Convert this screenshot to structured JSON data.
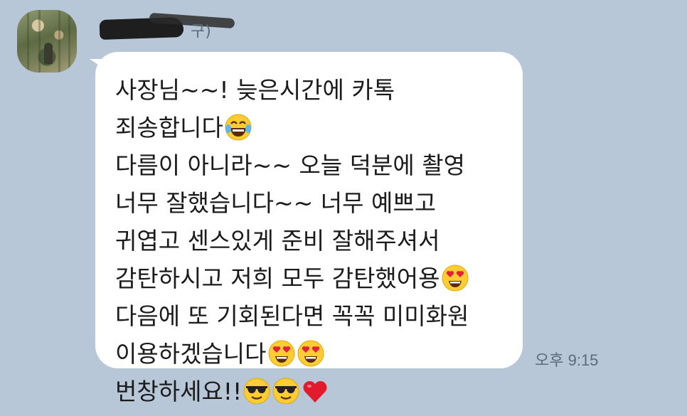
{
  "sender": {
    "name_suffix": "구)"
  },
  "message": {
    "lines": [
      {
        "text": "사장님~~! 늦은시간에 카톡",
        "emojis": []
      },
      {
        "text": "죄송합니다",
        "emojis": [
          "laugh-tears-emoji"
        ]
      },
      {
        "text": "다름이 아니라~~ 오늘 덕분에 촬영",
        "emojis": []
      },
      {
        "text": "너무 잘했습니다~~ 너무 예쁘고",
        "emojis": []
      },
      {
        "text": "귀엽고 센스있게 준비 잘해주셔서",
        "emojis": []
      },
      {
        "text": "감탄하시고 저희 모두 감탄했어용",
        "emojis": [
          "heart-eyes-emoji"
        ]
      },
      {
        "text": "다음에 또 기회된다면 꼭꼭 미미화원",
        "emojis": []
      },
      {
        "text": "이용하겠습니다",
        "emojis": [
          "heart-eyes-emoji",
          "heart-eyes-emoji"
        ]
      },
      {
        "text": "번창하세요!!",
        "emojis": [
          "sunglasses-emoji",
          "sunglasses-emoji",
          "red-heart-emoji"
        ]
      }
    ],
    "timestamp": "오후 9:15"
  },
  "colors": {
    "background": "#b8c7d7",
    "bubble": "#ffffff",
    "timestamp": "#5e6a78"
  }
}
